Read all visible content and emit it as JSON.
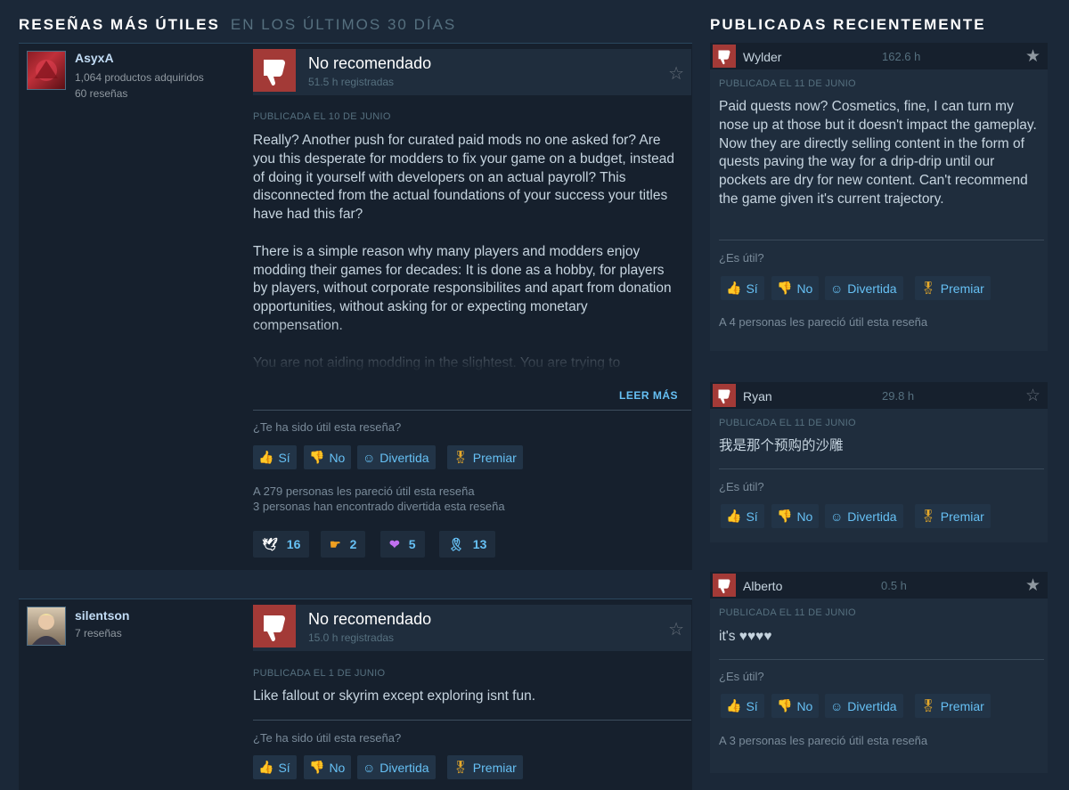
{
  "header": {
    "title": "RESEÑAS MÁS ÚTILES",
    "subtitle": "EN LOS ÚLTIMOS 30 DÍAS",
    "recent_title": "PUBLICADAS RECIENTEMENTE"
  },
  "reviews": [
    {
      "username": "AsyxA",
      "products": "1,064 productos adquiridos",
      "review_count": "60 reseñas",
      "verdict": "No recomendado",
      "hours": "51.5 h registradas",
      "posted": "PUBLICADA EL 10 DE JUNIO",
      "body": "Really? Another push for curated paid mods no one asked for? Are you this desperate for modders to fix your game on a budget, instead of doing it yourself with developers on an actual payroll? This disconnected from the actual foundations of your success your titles have had this far?\n\nThere is a simple reason why many players and modders enjoy modding their games for decades: It is done as a hobby, for players by players, without corporate responsibilites and apart from donation opportunities, without asking for or expecting monetary compensation.\n\nYou are not aiding modding in the slightest. You are trying to",
      "read_more": "LEER MÁS",
      "question": "¿Te ha sido útil esta reseña?",
      "helpful_summary": "A 279 personas les pareció útil esta reseña",
      "funny_summary": "3 personas han encontrado divertida esta reseña",
      "awards": [
        "16",
        "2",
        "5",
        "13"
      ]
    },
    {
      "username": "silentson",
      "review_count": "7 reseñas",
      "verdict": "No recomendado",
      "hours": "15.0 h registradas",
      "posted": "PUBLICADA EL 1 DE JUNIO",
      "body": "Like fallout or skyrim except exploring isnt fun.",
      "question": "¿Te ha sido útil esta reseña?"
    }
  ],
  "vote_labels": {
    "yes": "Sí",
    "no": "No",
    "funny": "Divertida",
    "award": "Premiar"
  },
  "recent": [
    {
      "name": "Wylder",
      "hours": "162.6 h",
      "posted": "PUBLICADA EL 11 DE JUNIO",
      "body": "Paid quests now? Cosmetics, fine, I can turn my nose up at those but it doesn't impact the gameplay. Now they are directly selling content in the form of quests paving the way for a drip-drip until our pockets are dry for new content. Can't recommend the game given it's current trajectory.",
      "question": "¿Es útil?",
      "summary": "A 4 personas les pareció útil esta reseña"
    },
    {
      "name": "Ryan",
      "hours": "29.8 h",
      "posted": "PUBLICADA EL 11 DE JUNIO",
      "body": "我是那个预购的沙雕",
      "question": "¿Es útil?"
    },
    {
      "name": "Alberto",
      "hours": "0.5 h",
      "posted": "PUBLICADA EL 11 DE JUNIO",
      "body": "it's ♥♥♥♥",
      "question": "¿Es útil?",
      "summary": "A 3 personas les pareció útil esta reseña"
    }
  ]
}
